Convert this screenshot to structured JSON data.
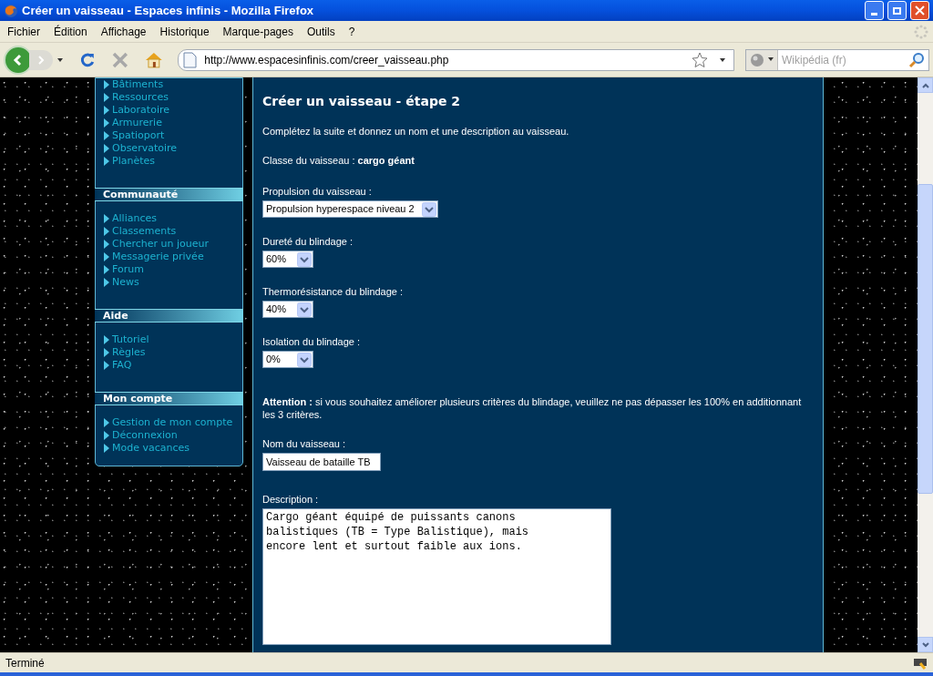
{
  "window": {
    "title": "Créer un vaisseau - Espaces infinis - Mozilla Firefox"
  },
  "menu": [
    "Fichier",
    "Édition",
    "Affichage",
    "Historique",
    "Marque-pages",
    "Outils",
    "?"
  ],
  "toolbar": {
    "url": "http://www.espacesinfinis.com/creer_vaisseau.php",
    "search_placeholder": "Wikipédia (fr)"
  },
  "sidebar": [
    {
      "items": [
        "Bâtiments",
        "Ressources",
        "Laboratoire",
        "Armurerie",
        "Spatioport",
        "Observatoire",
        "Planètes"
      ]
    },
    {
      "title": "Communauté",
      "items": [
        "Alliances",
        "Classements",
        "Chercher un joueur",
        "Messagerie privée",
        "Forum",
        "News"
      ]
    },
    {
      "title": "Aide",
      "items": [
        "Tutoriel",
        "Règles",
        "FAQ"
      ]
    },
    {
      "title": "Mon compte",
      "items": [
        "Gestion de mon compte",
        "Déconnexion",
        "Mode vacances"
      ]
    }
  ],
  "main": {
    "heading": "Créer un vaisseau - étape 2",
    "intro": "Complétez la suite et donnez un nom et une description au vaisseau.",
    "ship_class": "Classe du vaisseau : **cargo géant**",
    "selects": [
      {
        "label": "Propulsion du vaisseau :",
        "value": "Propulsion hyperespace niveau 2"
      },
      {
        "label": "Dureté du blindage :",
        "value": "60%"
      },
      {
        "label": "Thermorésistance du blindage :",
        "value": "40%"
      },
      {
        "label": "Isolation du blindage :",
        "value": "0%"
      }
    ],
    "warning": "**Attention :** si vous souhaitez améliorer plusieurs critères du blindage, veuillez ne pas dépasser les 100% en additionnant les 3 critères.",
    "name_label": "Nom du vaisseau :",
    "name_value": "Vaisseau de bataille TB",
    "description_label": "Description :",
    "description_value": "Cargo géant équipé de puissants canons\nbalistiques (TB = Type Balistique), mais\nencore lent et surtout faible aux ions."
  },
  "status_bar": "Terminé"
}
